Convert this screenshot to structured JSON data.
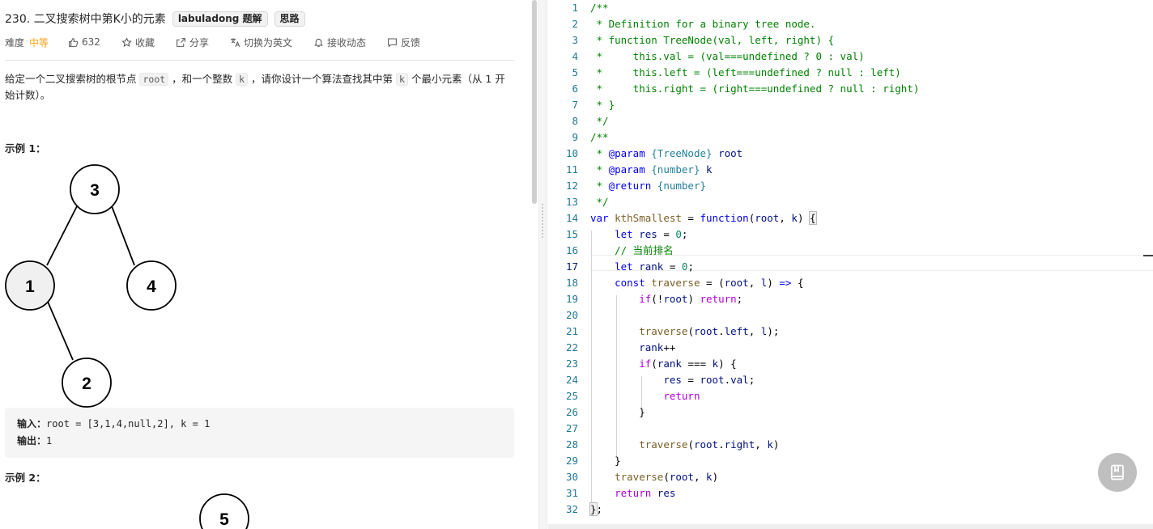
{
  "problem": {
    "title": "230. 二叉搜索树中第K小的元素",
    "tags": [
      "labuladong 题解",
      "思路"
    ],
    "difficulty_label": "难度",
    "difficulty_value": "中等",
    "likes": "632",
    "collect_label": "收藏",
    "share_label": "分享",
    "switch_lang_label": "切换为英文",
    "notify_label": "接收动态",
    "feedback_label": "反馈",
    "description": {
      "p1": "给定一个二叉搜索树的根节点 ",
      "code1": "root",
      "p2": " ，和一个整数 ",
      "code2": "k",
      "p3": " ，请你设计一个算法查找其中第 ",
      "code3": "k",
      "p4": " 个最小元素（从 1 开始计数）。"
    },
    "example1": {
      "label": "示例 1：",
      "tree_nodes": [
        "3",
        "1",
        "4",
        "2"
      ],
      "input_label": "输入：",
      "input_value": "root = [3,1,4,null,2], k = 1",
      "output_label": "输出：",
      "output_value": "1"
    },
    "example2": {
      "label": "示例 2：",
      "tree_root": "5"
    }
  },
  "editor": {
    "active_line": 17,
    "line_numbers": [
      "1",
      "2",
      "3",
      "4",
      "5",
      "6",
      "7",
      "8",
      "9",
      "10",
      "11",
      "12",
      "13",
      "14",
      "15",
      "16",
      "17",
      "18",
      "19",
      "20",
      "21",
      "22",
      "23",
      "24",
      "25",
      "26",
      "27",
      "28",
      "29",
      "30",
      "31",
      "32"
    ]
  },
  "icons": {
    "like": "thumbs-up-icon",
    "collect": "star-icon",
    "share": "share-icon",
    "translate": "translate-icon",
    "notify": "bell-icon",
    "feedback": "chat-icon",
    "float": "notebook-icon"
  },
  "colors": {
    "difficulty_medium": "#ffa116",
    "line_number": "#237893",
    "comment": "#008000",
    "keyword": "#0000ff",
    "control": "#af00db",
    "function": "#795e26",
    "variable": "#001080",
    "number": "#098658",
    "type": "#267f99"
  }
}
